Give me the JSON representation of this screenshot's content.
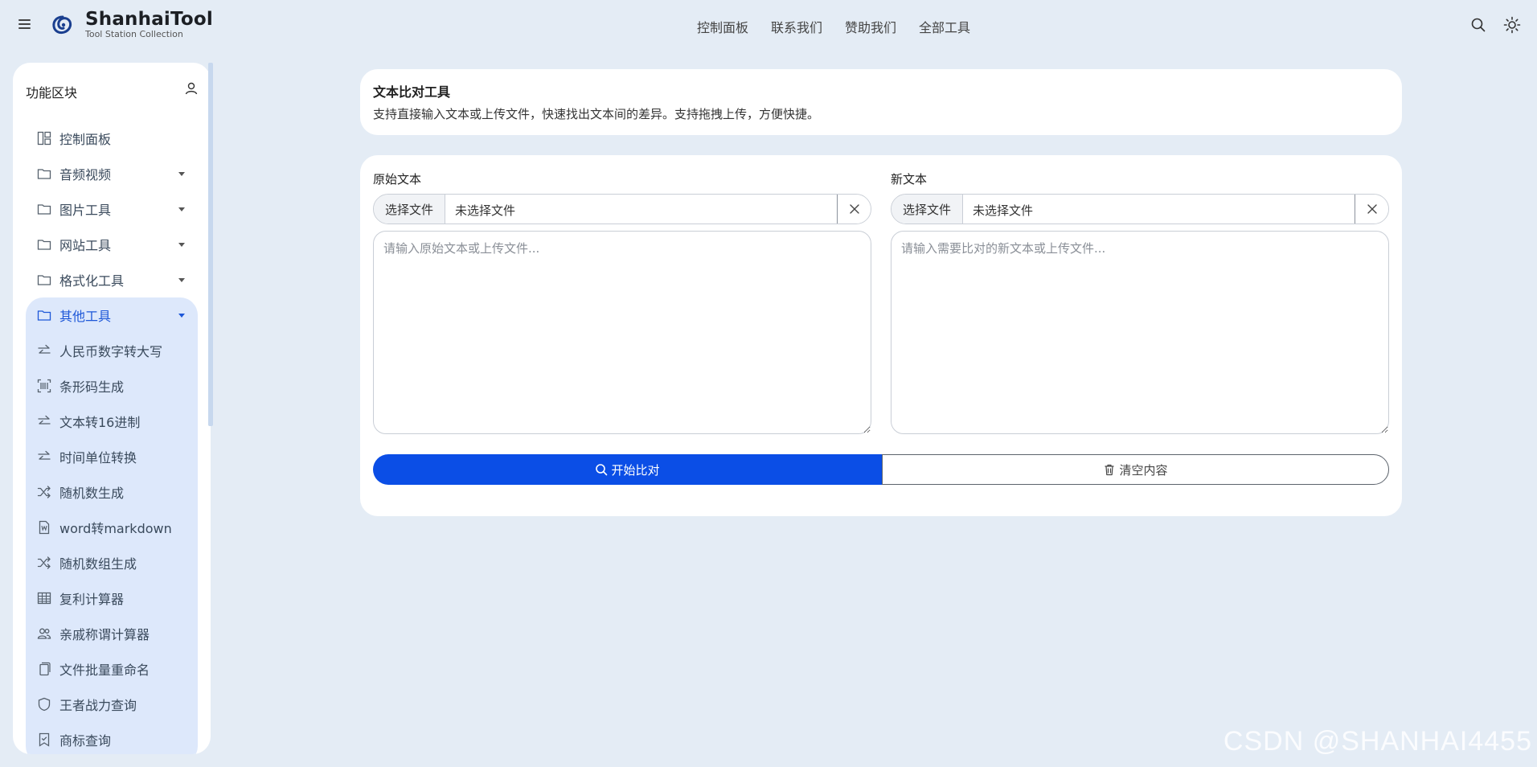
{
  "header": {
    "brand_name": "ShanhaiTool",
    "brand_sub": "Tool Station Collection",
    "nav": [
      "控制面板",
      "联系我们",
      "赞助我们",
      "全部工具"
    ]
  },
  "sidebar": {
    "title": "功能区块",
    "items": [
      {
        "label": "控制面板",
        "icon": "dashboard-icon"
      },
      {
        "label": "音频视频",
        "icon": "folder-icon"
      },
      {
        "label": "图片工具",
        "icon": "folder-icon"
      },
      {
        "label": "网站工具",
        "icon": "folder-icon"
      },
      {
        "label": "格式化工具",
        "icon": "folder-icon"
      }
    ],
    "open_group": {
      "label": "其他工具",
      "children": [
        {
          "label": "人民币数字转大写",
          "icon": "swap-icon"
        },
        {
          "label": "条形码生成",
          "icon": "barcode-icon"
        },
        {
          "label": "文本转16进制",
          "icon": "swap-icon"
        },
        {
          "label": "时间单位转换",
          "icon": "swap-icon"
        },
        {
          "label": "随机数生成",
          "icon": "shuffle-icon"
        },
        {
          "label": "word转markdown",
          "icon": "word-file-icon"
        },
        {
          "label": "随机数组生成",
          "icon": "shuffle-icon"
        },
        {
          "label": "复利计算器",
          "icon": "table-icon"
        },
        {
          "label": "亲戚称谓计算器",
          "icon": "people-icon"
        },
        {
          "label": "文件批量重命名",
          "icon": "files-icon"
        },
        {
          "label": "王者战力查询",
          "icon": "shield-icon"
        },
        {
          "label": "商标查询",
          "icon": "bookmark-check-icon"
        }
      ]
    }
  },
  "intro": {
    "title": "文本比对工具",
    "description": "支持直接输入文本或上传文件，快速找出文本间的差异。支持拖拽上传，方便快捷。"
  },
  "editor": {
    "left": {
      "label": "原始文本",
      "file_button": "选择文件",
      "file_name": "未选择文件",
      "placeholder": "请输入原始文本或上传文件..."
    },
    "right": {
      "label": "新文本",
      "file_button": "选择文件",
      "file_name": "未选择文件",
      "placeholder": "请输入需要比对的新文本或上传文件..."
    },
    "compare_button": "开始比对",
    "clear_button": "清空内容"
  },
  "watermark": "CSDN @SHANHAI4455",
  "colors": {
    "accent": "#0b4ee6",
    "background": "#e4ecf5",
    "active_group_bg": "#dde8fb",
    "active_text": "#1d57d8"
  }
}
